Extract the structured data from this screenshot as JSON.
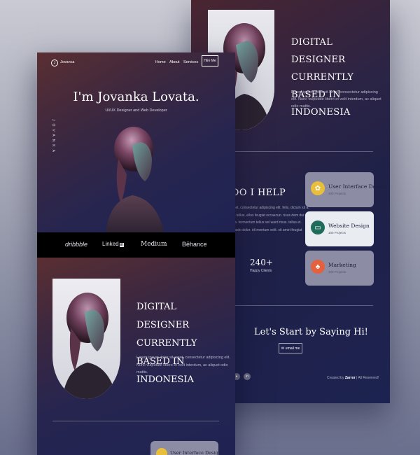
{
  "brand": {
    "logo_letter": "J",
    "logo_name": "Jovanca"
  },
  "nav": {
    "items": [
      {
        "label": "Home"
      },
      {
        "label": "About"
      },
      {
        "label": "Services"
      }
    ],
    "hire_label": "Hire Me"
  },
  "hero": {
    "title": "I'm Jovanka Lovata.",
    "subtitle": "UI/UX Designer and Web Developer",
    "vertical_name": "JOVANKA"
  },
  "partners": [
    "dribbble",
    "Linked",
    "Medium",
    "Bēhance"
  ],
  "about": {
    "title": "DIGITAL DESIGNER CURRENTLY BASED IN INDONESIA",
    "paragraph": "Lorem ipsum dolor sit amet, consectetur adipiscing elit. Nunc vulputate libero et velit interdum, ac aliquet odio mattis."
  },
  "help": {
    "title": "DO I HELP",
    "paragraph": "sit amet, consectetur adipiscing elit. felis, dictum sit a. mattis tellus. ellus feugiat occaecun. risus dem dui ac fringila. fermentum tellus vel ward risus. tellus et. commodo dolor. id imentum velit. sit amet feugiat",
    "stat_number": "240+",
    "stat_label": "Happy Clients"
  },
  "services": [
    {
      "title": "User Interface Design",
      "sub": "100 Projects",
      "icon": "paint-palette-icon",
      "color": "#e8bf3a",
      "bg": "#8c8ca4"
    },
    {
      "title": "Website Design",
      "sub": "100 Projects",
      "icon": "monitor-icon",
      "color": "#1f6b5c",
      "bg": "#e9ecf1"
    },
    {
      "title": "Marketing",
      "sub": "100 Projects",
      "icon": "team-icon",
      "color": "#e5603d",
      "bg": "#8c8ca4"
    }
  ],
  "cta": {
    "title": "Let's Start by Saying Hi!",
    "email_label": "email me"
  },
  "footer": {
    "credit_prefix": "Created by",
    "credit_name": "Zarror",
    "credit_suffix": "| All Reserved!"
  },
  "colors": {
    "accent_yellow": "#e8bf3a",
    "accent_green": "#1f6b5c",
    "accent_orange": "#e5603d",
    "navy": "#1f2352",
    "maroon": "#5a2f32"
  }
}
